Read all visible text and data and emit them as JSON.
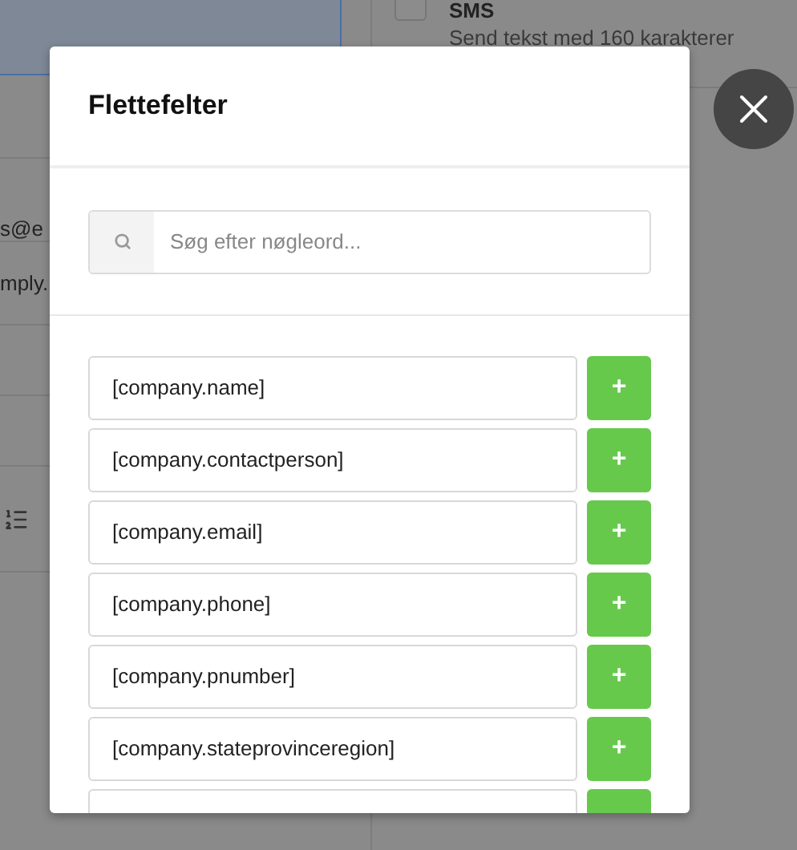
{
  "background": {
    "fragments": [
      "s@e",
      "mply."
    ],
    "sms_option": {
      "checked": false,
      "title": "SMS",
      "description": "Send tekst med 160 karakterer"
    }
  },
  "modal": {
    "title": "Flettefelter",
    "search": {
      "placeholder": "Søg efter nøgleord..."
    },
    "fields": [
      {
        "label": "[company.name]",
        "button": "+"
      },
      {
        "label": "[company.contactperson]",
        "button": "+"
      },
      {
        "label": "[company.email]",
        "button": "+"
      },
      {
        "label": "[company.phone]",
        "button": "+"
      },
      {
        "label": "[company.pnumber]",
        "button": "+"
      },
      {
        "label": "[company.stateprovinceregion]",
        "button": "+"
      }
    ],
    "more_below": true
  }
}
